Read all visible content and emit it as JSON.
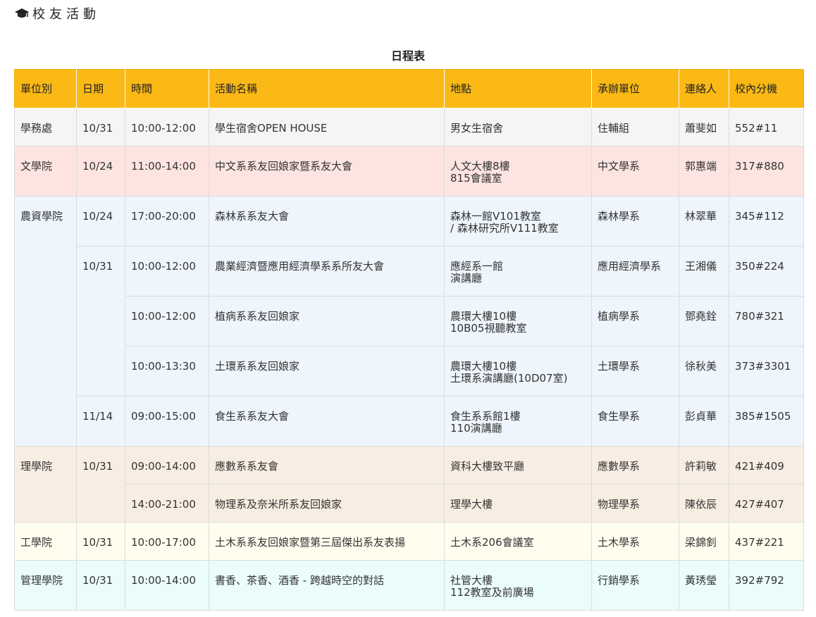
{
  "header": {
    "title": "校友活動",
    "icon": "graduation-cap-icon"
  },
  "table": {
    "caption": "日程表",
    "columns": [
      "單位別",
      "日期",
      "時間",
      "活動名稱",
      "地點",
      "承辦單位",
      "連絡人",
      "校內分機"
    ],
    "row_colors": {
      "student_affairs": "#f5f5f5",
      "liberal_arts": "#fde4e1",
      "bioresources": "#eef5fc",
      "science": "#f8ede2",
      "engineering": "#fffdee",
      "management": "#eafcfc",
      "header": "#fbb915"
    },
    "rows": [
      {
        "unit": "學務處",
        "date": "10/31",
        "time": "10:00-12:00",
        "activity": "學生宿舍OPEN HOUSE",
        "location": [
          "男女生宿舍"
        ],
        "organizer": "住輔組",
        "contact": "蕭斐如",
        "ext": "552#11"
      },
      {
        "unit": "文學院",
        "date": "10/24",
        "time": "11:00-14:00",
        "activity": "中文系系友回娘家暨系友大會",
        "location": [
          "人文大樓8樓",
          "815會議室"
        ],
        "organizer": "中文學系",
        "contact": "郭惠端",
        "ext": "317#880"
      },
      {
        "unit": "農資學院",
        "date": "10/24",
        "time": "17:00-20:00",
        "activity": "森林系系友大會",
        "location": [
          "森林一館V101教室",
          "/ 森林研究所V111教室"
        ],
        "organizer": "森林學系",
        "contact": "林翠華",
        "ext": "345#112"
      },
      {
        "date": "10/31",
        "time": "10:00-12:00",
        "activity": "農業經濟暨應用經濟學系系所友大會",
        "location": [
          "應經系一館",
          "演講廳"
        ],
        "organizer": "應用經濟學系",
        "contact": "王湘儀",
        "ext": "350#224"
      },
      {
        "time": "10:00-12:00",
        "activity": "植病系系友回娘家",
        "location": [
          "農環大樓10樓",
          "10B05視聽教室"
        ],
        "organizer": "植病學系",
        "contact": "鄧堯銓",
        "ext": "780#321"
      },
      {
        "time": "10:00-13:30",
        "activity": "土環系系友回娘家",
        "location": [
          "農環大樓10樓",
          "土環系演講廳(10D07室)"
        ],
        "organizer": "土環學系",
        "contact": "徐秋美",
        "ext": "373#3301"
      },
      {
        "date": "11/14",
        "time": "09:00-15:00",
        "activity": "食生系系友大會",
        "location": [
          "食生系系館1樓",
          "110演講廳"
        ],
        "organizer": "食生學系",
        "contact": "彭貞華",
        "ext": "385#1505"
      },
      {
        "unit": "理學院",
        "date": "10/31",
        "time": "09:00-14:00",
        "activity": "應數系系友會",
        "location": [
          "資科大樓致平廳"
        ],
        "organizer": "應數學系",
        "contact": "許莉敏",
        "ext": "421#409"
      },
      {
        "time": "14:00-21:00",
        "activity": "物理系及奈米所系友回娘家",
        "location": [
          "理學大樓"
        ],
        "organizer": "物理學系",
        "contact": "陳依辰",
        "ext": "427#407"
      },
      {
        "unit": "工學院",
        "date": "10/31",
        "time": "10:00-17:00",
        "activity": "土木系系友回娘家暨第三屆傑出系友表揚",
        "location": [
          "土木系206會議室"
        ],
        "organizer": "土木學系",
        "contact": "梁錦釗",
        "ext": "437#221"
      },
      {
        "unit": "管理學院",
        "date": "10/31",
        "time": "10:00-14:00",
        "activity": "書香、茶香、酒香 - 跨越時空的對話",
        "location": [
          "社管大樓",
          "112教室及前廣場"
        ],
        "organizer": "行銷學系",
        "contact": "黃琇瑩",
        "ext": "392#792"
      }
    ]
  }
}
